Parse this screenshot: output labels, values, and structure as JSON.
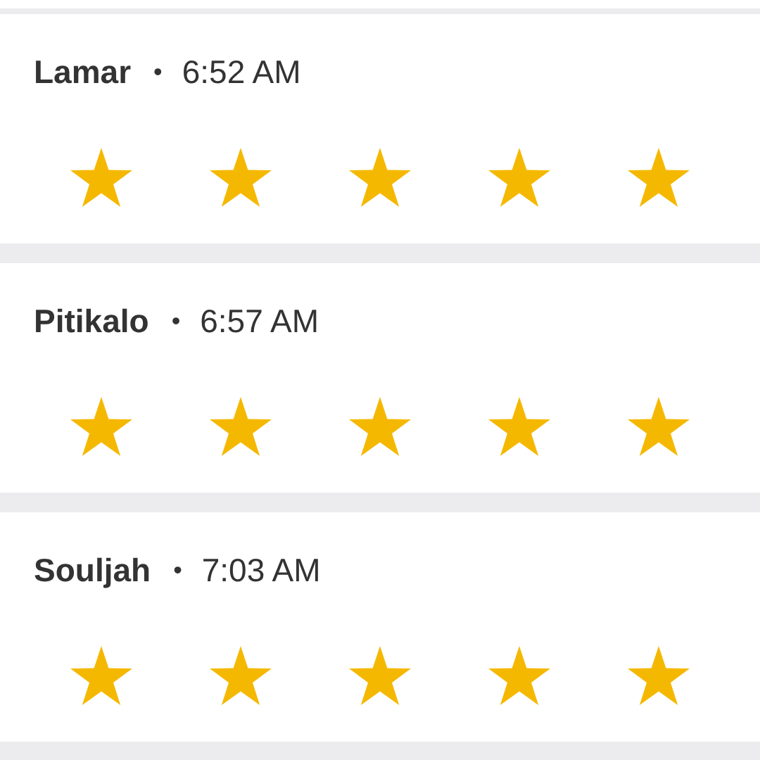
{
  "rides": [
    {
      "driver": "Lamar",
      "separator": "•",
      "time": "6:52 AM",
      "stars": 5
    },
    {
      "driver": "Pitikalo",
      "separator": "•",
      "time": "6:57 AM",
      "stars": 5
    },
    {
      "driver": "Souljah",
      "separator": "•",
      "time": "7:03 AM",
      "stars": 5
    }
  ]
}
